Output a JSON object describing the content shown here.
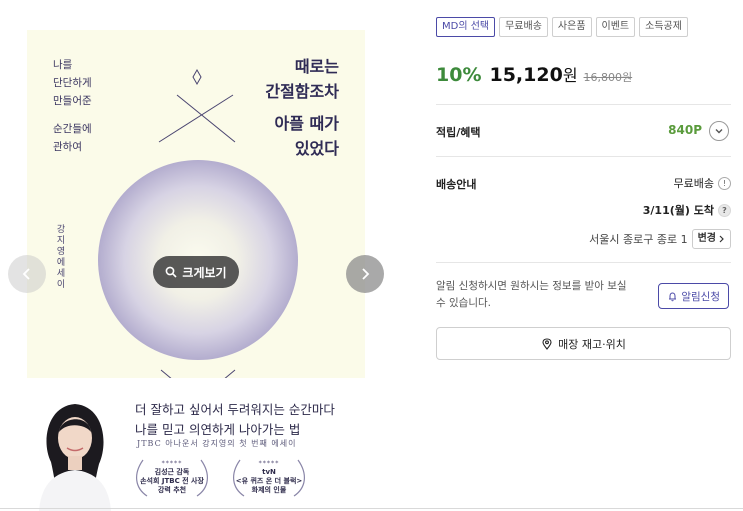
{
  "cover": {
    "meta_lines": [
      "나를",
      "단단하게",
      "만들어준",
      "순간들에",
      "관하여"
    ],
    "title_lines": [
      "때로는",
      "간절함조차",
      "아플 때가",
      "있었다"
    ],
    "author_vertical": "강지영에세이",
    "zoom_label": "크게보기",
    "tagline_lines": [
      "더 잘하고 싶어서 두려워지는 순간마다",
      "나를 믿고 의연하게 나아가는 법"
    ],
    "sub_tagline": "JTBC 아나운서 강지영의 첫 번째 에세이",
    "awards": [
      {
        "stars": "*****",
        "lines": [
          "김성근 감독",
          "손석희 JTBC 전 사장",
          "강력 추천"
        ]
      },
      {
        "stars": "*****",
        "lines": [
          "tvN",
          "<유 퀴즈 온 더 블럭>",
          "화제의 인물"
        ]
      }
    ]
  },
  "badges": [
    "MD의 선택",
    "무료배송",
    "사은품",
    "이벤트",
    "소득공제"
  ],
  "price": {
    "discount": "10%",
    "amount": "15,120",
    "unit": "원",
    "original": "16,800원"
  },
  "points": {
    "label": "적립/혜택",
    "value": "840P"
  },
  "shipping": {
    "label": "배송안내",
    "type": "무료배송",
    "info_icon": "!",
    "date": "3/11(월) 도착",
    "help_icon": "?",
    "address": "서울시 종로구 종로 1",
    "change_label": "변경"
  },
  "notify": {
    "text": "알림 신청하시면 원하시는 정보를 받아 보실 수 있습니다.",
    "button_label": "알림신청"
  },
  "stock": {
    "button_label": "매장 재고·위치"
  },
  "colors": {
    "accent": "#4b4aa7",
    "discount": "#3d8a3b",
    "points": "#5a9b3c"
  }
}
